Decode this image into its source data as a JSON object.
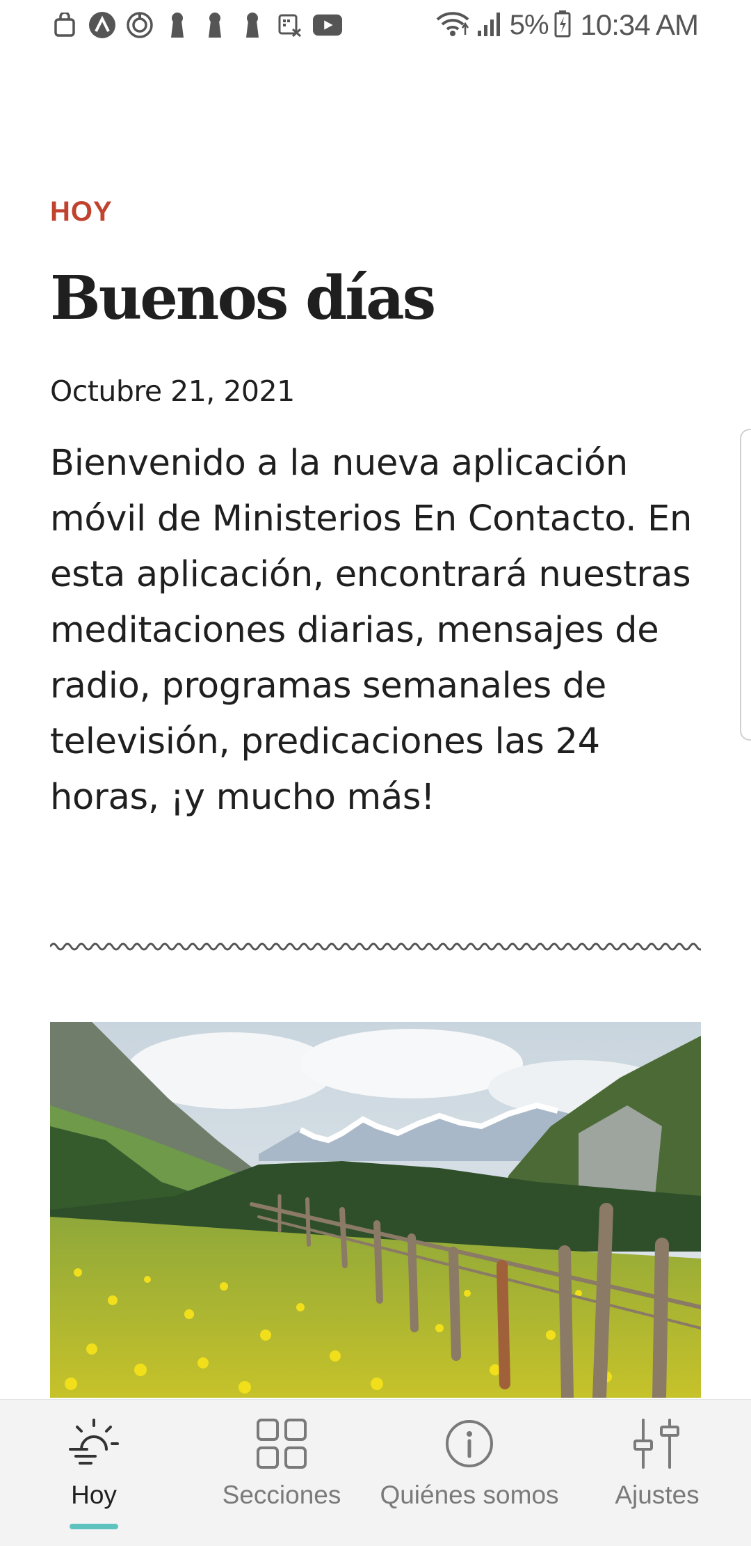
{
  "status_bar": {
    "left_icons": [
      "bag-icon",
      "app-a-icon",
      "sync-icon",
      "keyhole-icon",
      "keyhole-icon",
      "keyhole-icon",
      "dex-icon",
      "youtube-icon"
    ],
    "battery_percent": "5%",
    "time": "10:34 AM"
  },
  "today": {
    "section_label": "HOY",
    "greeting": "Buenos días",
    "date": "Octubre 21, 2021",
    "welcome_text": "Bienvenido a la nueva aplicación móvil de Ministerios En Contacto. En esta aplicación,  encontrará nuestras meditaciones diarias, mensajes de radio, programas semanales de televisión, predicaciones las 24 horas, ¡y mucho más!"
  },
  "hero": {
    "image": "alpine-meadow-with-fence"
  },
  "bottom_nav": {
    "items": [
      {
        "label": "Hoy",
        "icon": "sun-icon",
        "active": true
      },
      {
        "label": "Secciones",
        "icon": "grid-icon",
        "active": false
      },
      {
        "label": "Quiénes somos",
        "icon": "info-icon",
        "active": false
      },
      {
        "label": "Ajustes",
        "icon": "sliders-icon",
        "active": false
      }
    ]
  },
  "colors": {
    "accent": "#c0432f",
    "nav_indicator": "#5ec3bf",
    "text": "#1f1f1f",
    "muted": "#7a7a7a"
  }
}
